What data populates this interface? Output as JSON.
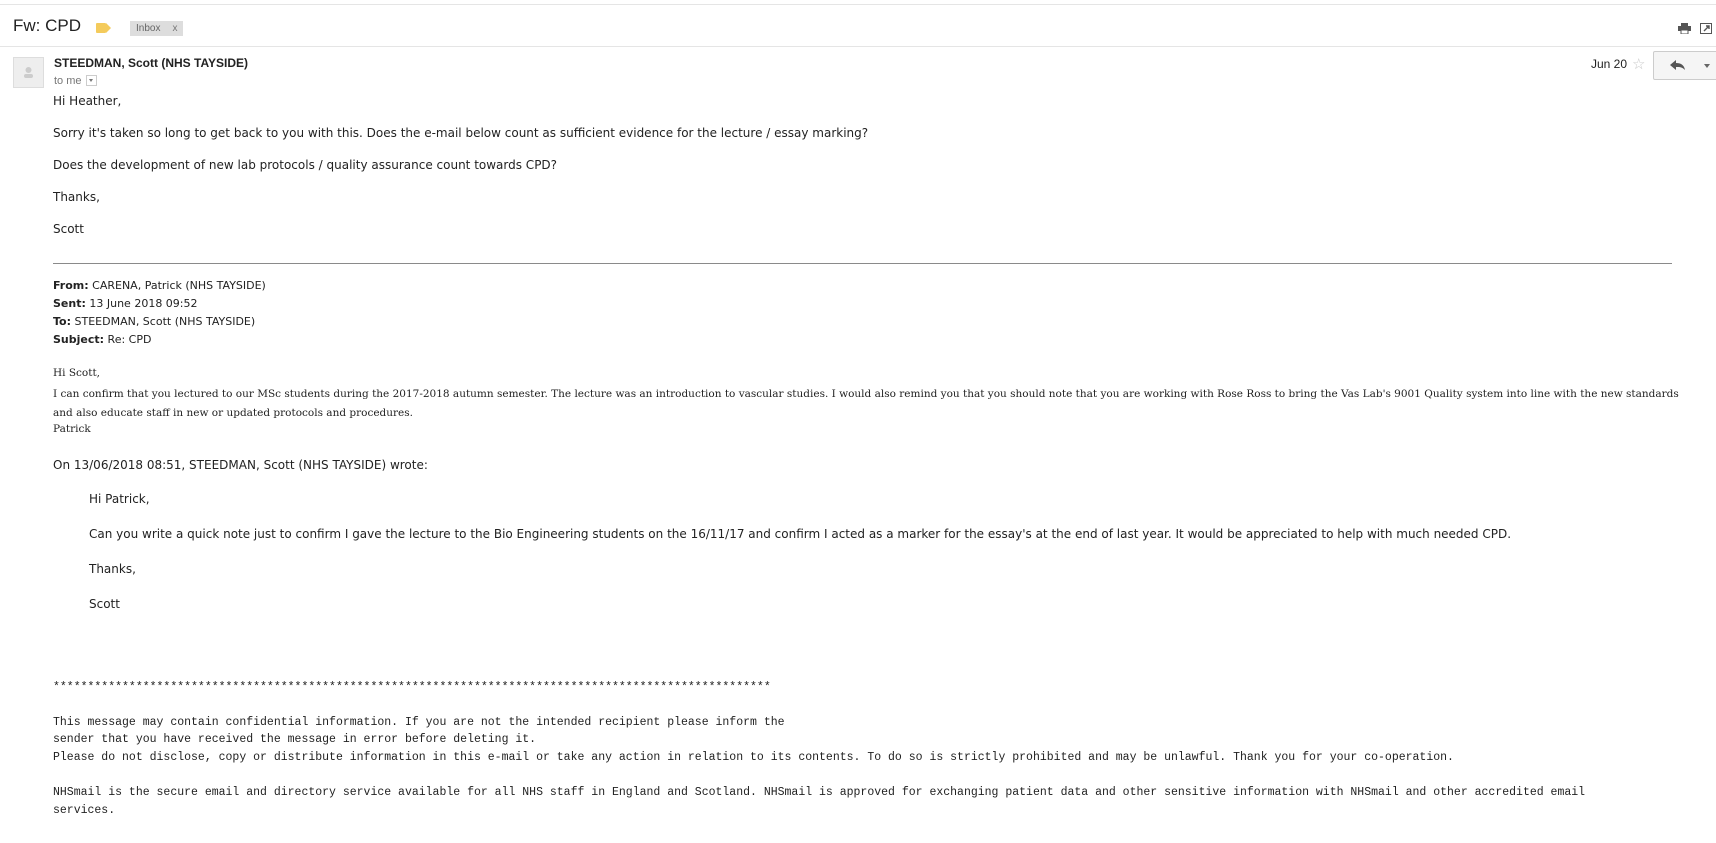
{
  "thread": {
    "subject": "Fw: CPD",
    "label": "Inbox",
    "label_close": "x"
  },
  "message": {
    "sender": "STEEDMAN, Scott (NHS TAYSIDE)",
    "to": "to me",
    "date": "Jun 20",
    "body": [
      "Hi Heather,",
      "Sorry it's taken so long to get back to you with this. Does the e-mail below count as sufficient evidence for the lecture / essay marking?",
      "Does the development of new lab protocols / quality assurance count towards CPD?",
      "Thanks,",
      "Scott"
    ]
  },
  "forwarded": {
    "from_label": "From:",
    "from": "CARENA, Patrick (NHS TAYSIDE)",
    "sent_label": "Sent:",
    "sent": "13 June 2018 09:52",
    "to_label": "To:",
    "to": "STEEDMAN, Scott (NHS TAYSIDE)",
    "subject_label": "Subject:",
    "subject": "Re: CPD",
    "greeting": "Hi Scott,",
    "para": "I can confirm that you lectured to our MSc students during the 2017-2018 autumn semester. The lecture was an introduction to vascular studies. I would also remind you that you should note that you are working with Rose Ross to bring the Vas Lab's 9001 Quality system into line with the new standards and also educate staff in new or updated protocols and procedures.",
    "signoff": "Patrick",
    "wrote": "On 13/06/2018 08:51, STEEDMAN, Scott (NHS TAYSIDE) wrote:"
  },
  "quoted": {
    "lines": [
      "Hi Patrick,",
      "Can you write a quick note just to confirm I gave the lecture to the Bio Engineering students on the 16/11/17 and confirm I acted as a marker for the essay's at the end of last year. It would be appreciated to help with much needed CPD.",
      "Thanks,",
      "Scott"
    ]
  },
  "disclaimer": {
    "stars": "********************************************************************************************************",
    "line1": "This message may contain confidential information. If you are not the intended recipient please inform the",
    "line2": "sender that you have received the message in error before deleting it.",
    "line3": "Please do not disclose, copy or distribute information in this e-mail or take any action in relation to its contents. To do so is strictly prohibited and may be unlawful. Thank you for your co-operation.",
    "line4": "NHSmail is the secure email and directory service available for all NHS staff in England and Scotland. NHSmail is approved for exchanging patient data and other sensitive information with NHSmail and other accredited email",
    "line5": "services."
  }
}
